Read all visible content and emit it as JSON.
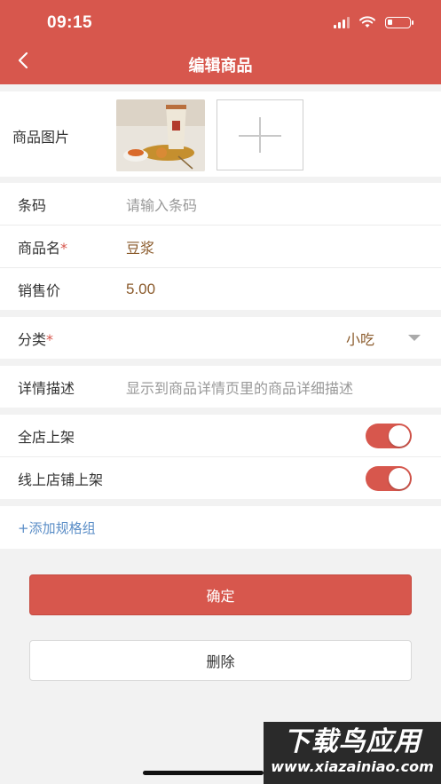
{
  "status_bar": {
    "time": "09:15"
  },
  "header": {
    "title": "编辑商品"
  },
  "image_row": {
    "label": "商品图片"
  },
  "fields": {
    "barcode": {
      "label": "条码",
      "placeholder": "请输入条码"
    },
    "name": {
      "label": "商品名",
      "required_mark": "*",
      "value": "豆浆"
    },
    "price": {
      "label": "销售价",
      "value": "5.00"
    }
  },
  "category": {
    "label": "分类",
    "required_mark": "*",
    "value": "小吃"
  },
  "description": {
    "label": "详情描述",
    "placeholder": "显示到商品详情页里的商品详细描述"
  },
  "toggles": [
    {
      "label": "全店上架",
      "on": true
    },
    {
      "label": "线上店铺上架",
      "on": true
    }
  ],
  "add_spec_label": "+添加规格组",
  "buttons": {
    "confirm": "确定",
    "delete": "删除"
  },
  "watermark": {
    "brand": "下载鸟应用",
    "url": "www.xiazainiao.com"
  },
  "colors": {
    "accent": "#d7574d",
    "value_text": "#8a5a2b",
    "link": "#5b8ec7"
  }
}
